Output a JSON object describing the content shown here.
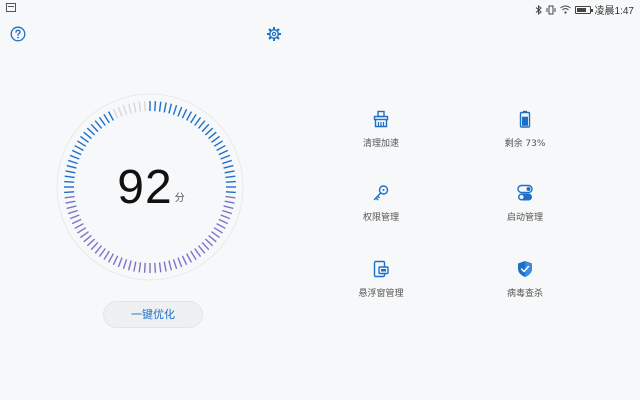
{
  "status_bar": {
    "time": "凌晨1:47"
  },
  "header": {
    "help_icon": "help-circle-icon",
    "settings_icon": "gear-icon"
  },
  "score": {
    "value": "92",
    "unit": "分",
    "level": 0.92
  },
  "optimize_button": {
    "label": "一键优化"
  },
  "tools": [
    {
      "label": "清理加速",
      "icon": "broom-icon"
    },
    {
      "label": "剩余 73%",
      "icon": "battery-icon",
      "battery_level": 0.73
    },
    {
      "label": "权限管理",
      "icon": "key-icon"
    },
    {
      "label": "启动管理",
      "icon": "toggle-icon"
    },
    {
      "label": "悬浮窗管理",
      "icon": "floating-window-icon"
    },
    {
      "label": "病毒查杀",
      "icon": "shield-icon"
    }
  ],
  "colors": {
    "accent": "#1e6fc8",
    "inactive_tick": "#d5d8dc",
    "gradient_end": "#7b73c9"
  }
}
